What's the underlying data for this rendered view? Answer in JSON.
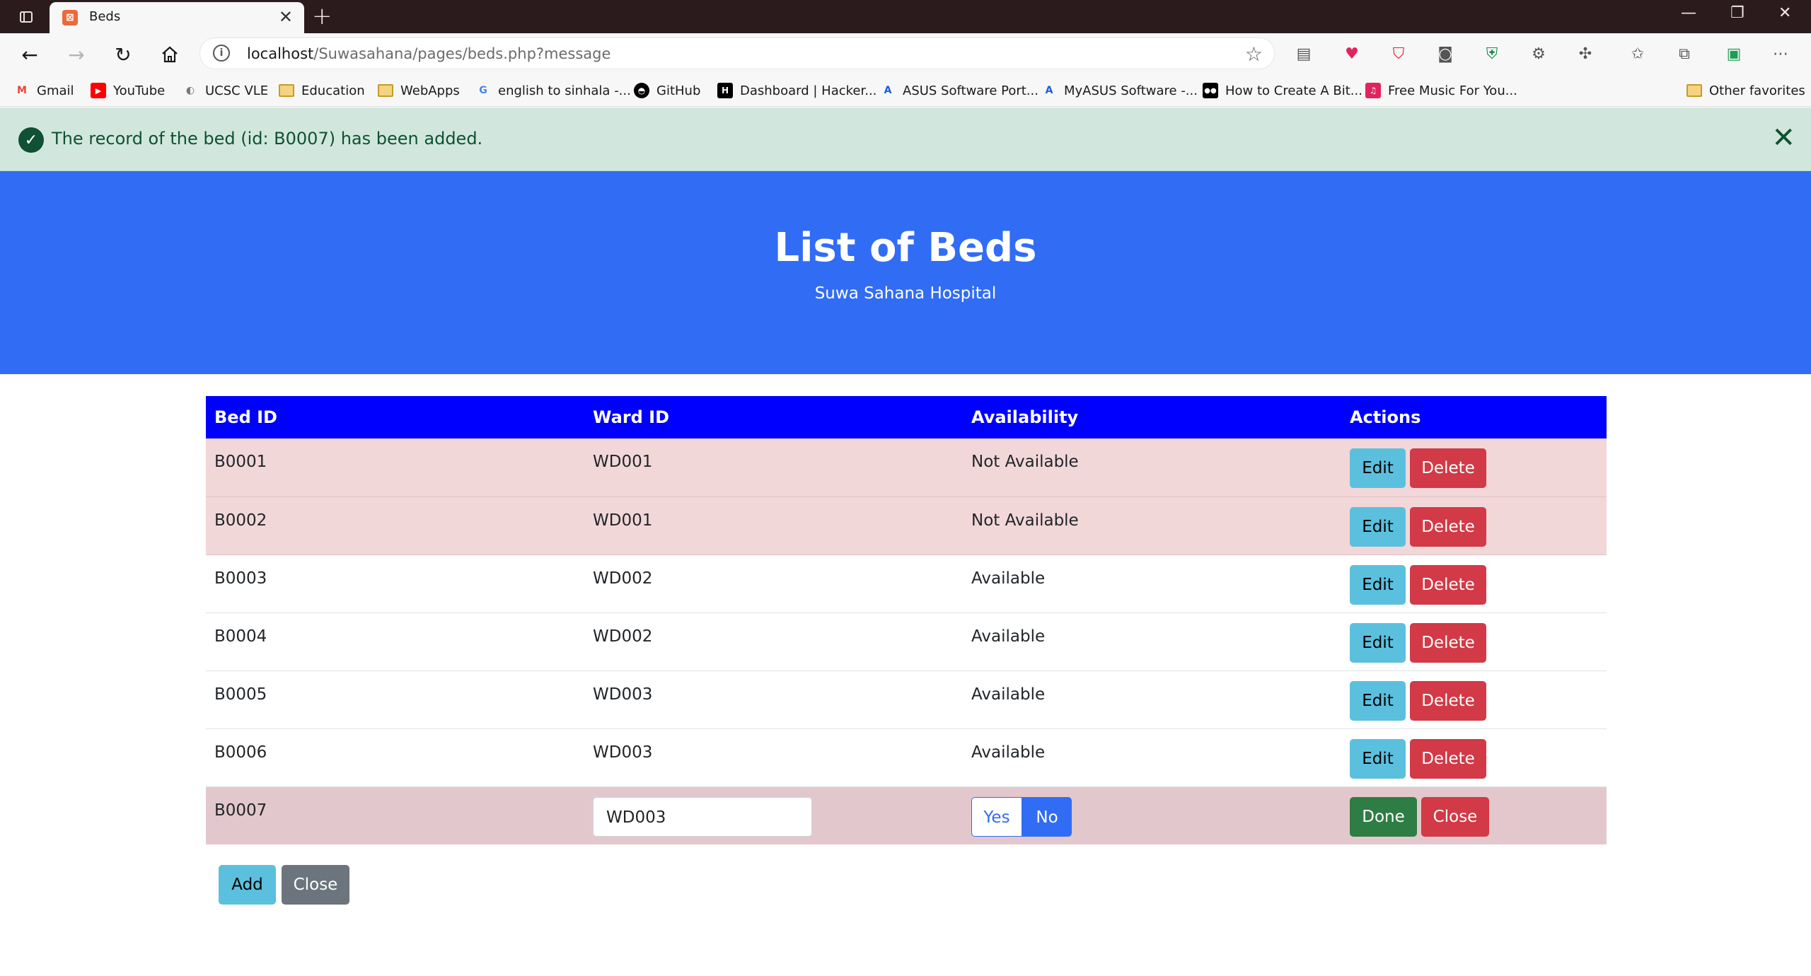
{
  "browser": {
    "tab_title": "Beds",
    "tab_favicon": "xampp-icon",
    "address_host": "localhost",
    "address_path": "/Suwasahana/pages/beds.php?message",
    "favorites": [
      {
        "label": "Gmail",
        "icon": "gmail-icon",
        "color": "#ea4335",
        "glyph": "M"
      },
      {
        "label": "YouTube",
        "icon": "youtube-icon",
        "color": "#ff0000",
        "glyph": "▶"
      },
      {
        "label": "UCSC VLE",
        "icon": "ucsc-icon",
        "color": "#777777",
        "glyph": "◐"
      },
      {
        "label": "Education",
        "icon": "folder-icon"
      },
      {
        "label": "WebApps",
        "icon": "folder-icon"
      },
      {
        "label": "english to sinhala -...",
        "icon": "google-icon",
        "color": "#4285f4",
        "glyph": "G"
      },
      {
        "label": "GitHub",
        "icon": "github-icon",
        "color": "#000000",
        "glyph": "●"
      },
      {
        "label": "Dashboard | Hacker...",
        "icon": "hackerrank-icon",
        "color": "#000000",
        "glyph": "H"
      },
      {
        "label": "ASUS Software Port...",
        "icon": "asus-icon",
        "color": "#1a5fd6",
        "glyph": "A"
      },
      {
        "label": "MyASUS Software -...",
        "icon": "asus-icon",
        "color": "#1a5fd6",
        "glyph": "A"
      },
      {
        "label": "How to Create A Bit...",
        "icon": "medium-icon",
        "color": "#000000",
        "glyph": "●"
      },
      {
        "label": "Free Music For You...",
        "icon": "music-icon",
        "color": "#e0245e",
        "glyph": "♫"
      }
    ],
    "other_favorites": "Other favorites"
  },
  "alert": {
    "message": "The record of the bed (id: B0007) has been added."
  },
  "header": {
    "title": "List of Beds",
    "subtitle": "Suwa Sahana Hospital"
  },
  "table": {
    "columns": [
      "Bed ID",
      "Ward ID",
      "Availability",
      "Actions"
    ],
    "rows": [
      {
        "bed_id": "B0001",
        "ward_id": "WD001",
        "availability": "Not Available"
      },
      {
        "bed_id": "B0002",
        "ward_id": "WD001",
        "availability": "Not Available"
      },
      {
        "bed_id": "B0003",
        "ward_id": "WD002",
        "availability": "Available"
      },
      {
        "bed_id": "B0004",
        "ward_id": "WD002",
        "availability": "Available"
      },
      {
        "bed_id": "B0005",
        "ward_id": "WD003",
        "availability": "Available"
      },
      {
        "bed_id": "B0006",
        "ward_id": "WD003",
        "availability": "Available"
      }
    ],
    "edit_label": "Edit",
    "delete_label": "Delete",
    "new_row": {
      "bed_id": "B0007",
      "ward_value": "WD003",
      "yes_label": "Yes",
      "no_label": "No",
      "done_label": "Done",
      "close_label": "Close"
    }
  },
  "footer_buttons": {
    "add_label": "Add",
    "close_label": "Close"
  },
  "colors": {
    "hero": "#316cf4",
    "table_header": "#0000ff",
    "unavailable_row": "#f2d7d9",
    "editing_row": "#e2c8cc",
    "alert_bg": "#d1e7dd"
  }
}
